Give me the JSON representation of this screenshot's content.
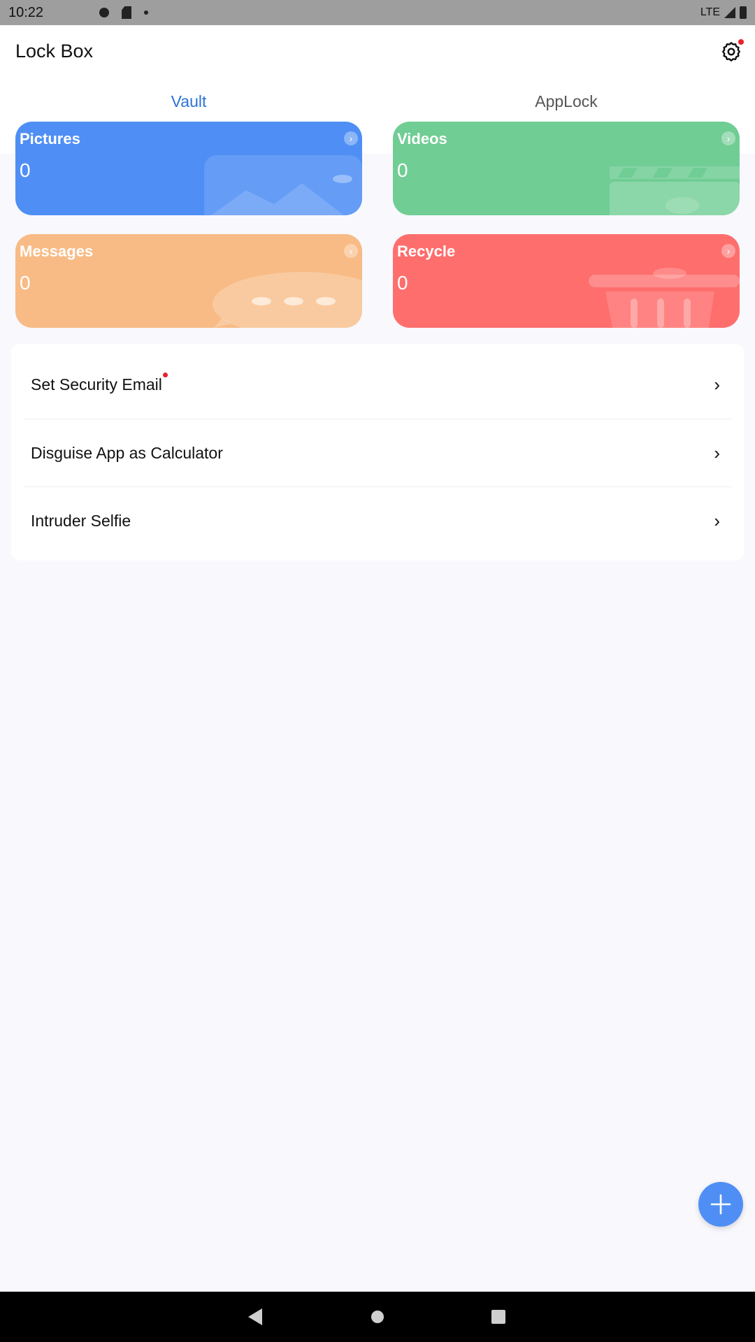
{
  "status_bar": {
    "time": "10:22",
    "network": "LTE"
  },
  "app": {
    "title": "Lock Box"
  },
  "tabs": [
    {
      "label": "Vault",
      "active": true
    },
    {
      "label": "AppLock",
      "active": false
    }
  ],
  "cards": {
    "pictures": {
      "title": "Pictures",
      "count": "0",
      "color": "#4f8ff5"
    },
    "videos": {
      "title": "Videos",
      "count": "0",
      "color": "#70cd94"
    },
    "messages": {
      "title": "Messages",
      "count": "0",
      "color": "#f8bb85"
    },
    "recycle": {
      "title": "Recycle",
      "count": "0",
      "color": "#fe6e6d"
    }
  },
  "settings": [
    {
      "label": "Set Security Email",
      "badge": true
    },
    {
      "label": "Disguise App as Calculator",
      "badge": false
    },
    {
      "label": "Intruder Selfie",
      "badge": false
    }
  ],
  "colors": {
    "accent": "#2c73d8",
    "badge": "#e8222c",
    "fab": "#4f8ff5"
  },
  "icons": {
    "settings": "gear-icon",
    "chevron": "chevron-right-icon",
    "fab": "plus-icon"
  }
}
